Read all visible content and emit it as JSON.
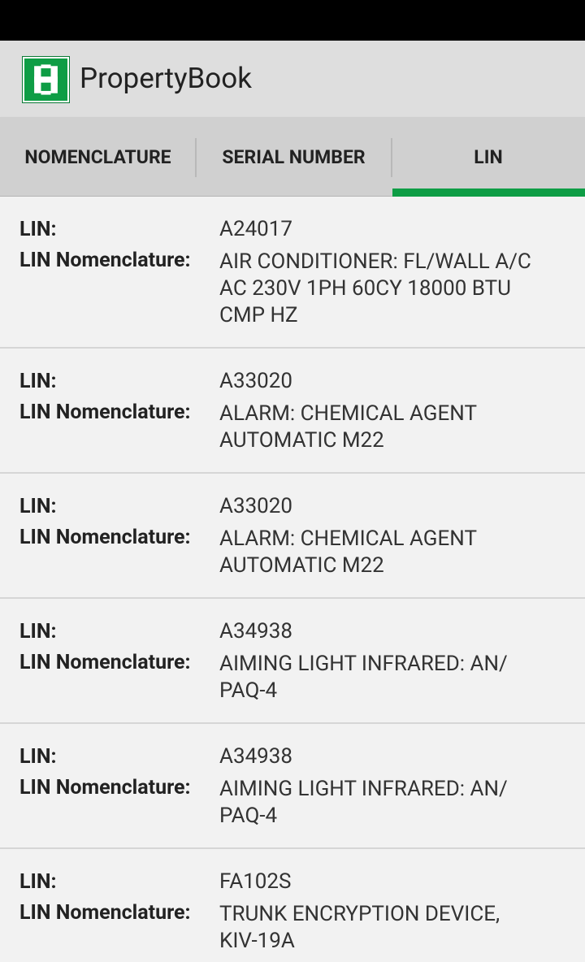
{
  "app": {
    "title": "PropertyBook",
    "icon": "app-logo-icon",
    "accent_color": "#0e9d45"
  },
  "tabs": [
    {
      "label": "NOMENCLATURE",
      "selected": false
    },
    {
      "label": "SERIAL NUMBER",
      "selected": false
    },
    {
      "label": "LIN",
      "selected": true
    }
  ],
  "labels": {
    "lin": "LIN:",
    "lin_nomenclature": "LIN Nomenclature:"
  },
  "items": [
    {
      "lin": "A24017",
      "nomenclature_lines": [
        "AIR CONDITIONER: FL/WALL A/C",
        "AC 230V 1PH 60CY 18000 BTU",
        "CMP HZ"
      ]
    },
    {
      "lin": "A33020",
      "nomenclature_lines": [
        "ALARM: CHEMICAL AGENT",
        "AUTOMATIC M22"
      ]
    },
    {
      "lin": "A33020",
      "nomenclature_lines": [
        "ALARM: CHEMICAL AGENT",
        "AUTOMATIC M22"
      ]
    },
    {
      "lin": "A34938",
      "nomenclature_lines": [
        "AIMING LIGHT INFRARED: AN/",
        "PAQ-4"
      ]
    },
    {
      "lin": "A34938",
      "nomenclature_lines": [
        "AIMING LIGHT INFRARED: AN/",
        "PAQ-4"
      ]
    },
    {
      "lin": "FA102S",
      "nomenclature_lines": [
        "TRUNK ENCRYPTION DEVICE,",
        "KIV-19A"
      ]
    }
  ]
}
